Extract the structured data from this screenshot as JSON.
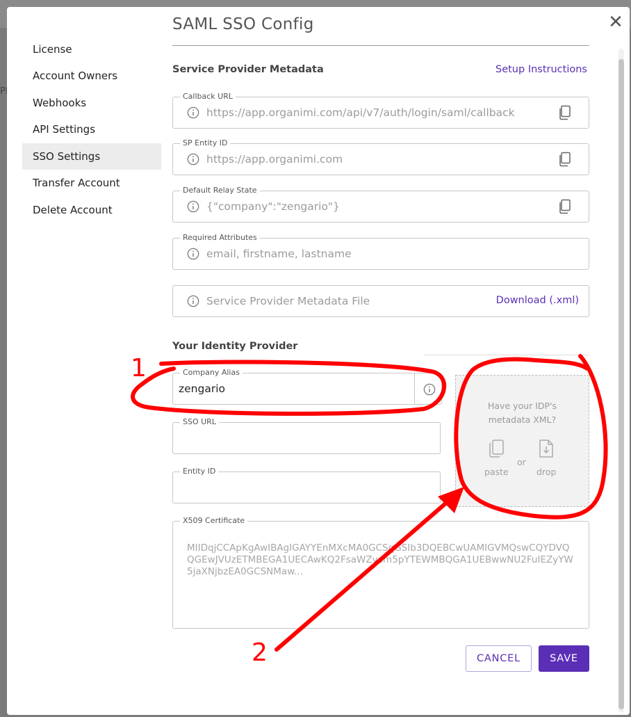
{
  "background": {
    "right_text": "PI"
  },
  "sidebar": {
    "items": [
      {
        "label": "License"
      },
      {
        "label": "Account Owners"
      },
      {
        "label": "Webhooks"
      },
      {
        "label": "API Settings"
      },
      {
        "label": "SSO Settings"
      },
      {
        "label": "Transfer Account"
      },
      {
        "label": "Delete Account"
      }
    ],
    "active": "SSO Settings"
  },
  "page": {
    "title": "SAML SSO Config"
  },
  "sp": {
    "heading": "Service Provider Metadata",
    "setup_link": "Setup Instructions",
    "callback": {
      "label": "Callback URL",
      "value": "https://app.organimi.com/api/v7/auth/login/saml/callback"
    },
    "entity": {
      "label": "SP Entity ID",
      "value": "https://app.organimi.com"
    },
    "relay": {
      "label": "Default Relay State",
      "value": "{\"company\":\"zengario\"}"
    },
    "attributes": {
      "label": "Required Attributes",
      "value": "email, firstname, lastname"
    },
    "metadata_file": {
      "value": "Service Provider Metadata File",
      "link": "Download (.xml)"
    }
  },
  "idp": {
    "heading": "Your Identity Provider",
    "company_alias": {
      "label": "Company Alias",
      "value": "zengario"
    },
    "sso_url": {
      "label": "SSO URL",
      "value": ""
    },
    "entity_id": {
      "label": "Entity ID",
      "value": ""
    },
    "x509": {
      "label": "X509 Certificate",
      "placeholder": "MIIDqjCCApKgAwIBAgIGAYYEnMXcMA0GCSqGSIb3DQEBCwUAMIGVMQswCQYDVQQGEwJVUzETMBEGA1UECAwKQ2FsaWZvcm5pYTEWMBQGA1UEBwwNU2FuIEZyYW5jaXNjbzEA0GCSNMaw..."
    },
    "drop": {
      "question_line1": "Have your IDP's",
      "question_line2": "metadata XML?",
      "paste": "paste",
      "or": "or",
      "drop": "drop"
    }
  },
  "buttons": {
    "cancel": "CANCEL",
    "save": "SAVE"
  },
  "annotations": {
    "label_1": "1",
    "label_2": "2",
    "color": "#ff0000"
  },
  "colors": {
    "accent": "#5a2fb5",
    "annotation": "#ff0000"
  },
  "icons": {
    "close": "close-icon",
    "info": "info-icon",
    "copy": "copy-icon",
    "paste": "paste-icon",
    "drop": "download-file-icon"
  }
}
